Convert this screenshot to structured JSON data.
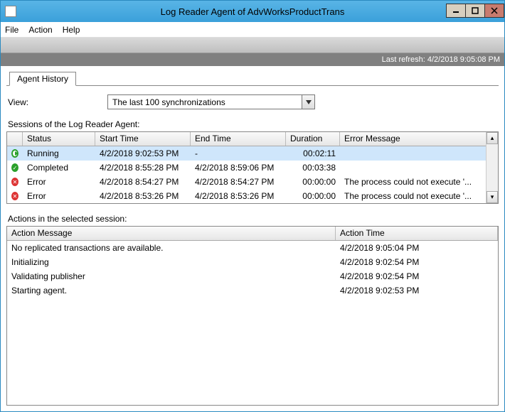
{
  "window": {
    "title": "Log Reader Agent of AdvWorksProductTrans"
  },
  "menu": {
    "file": "File",
    "action": "Action",
    "help": "Help"
  },
  "refresh_bar": "Last refresh: 4/2/2018 9:05:08 PM",
  "tab": {
    "agent_history": "Agent History"
  },
  "view": {
    "label": "View:",
    "selected": "The last 100 synchronizations"
  },
  "sessions": {
    "label": "Sessions of the Log Reader Agent:",
    "columns": {
      "c0": "",
      "status": "Status",
      "start": "Start Time",
      "end": "End Time",
      "duration": "Duration",
      "error": "Error Message"
    },
    "rows": [
      {
        "icon": "running",
        "status": "Running",
        "start": "4/2/2018 9:02:53 PM",
        "end": "-",
        "duration": "00:02:11",
        "error": ""
      },
      {
        "icon": "completed",
        "status": "Completed",
        "start": "4/2/2018 8:55:28 PM",
        "end": "4/2/2018 8:59:06 PM",
        "duration": "00:03:38",
        "error": ""
      },
      {
        "icon": "error",
        "status": "Error",
        "start": "4/2/2018 8:54:27 PM",
        "end": "4/2/2018 8:54:27 PM",
        "duration": "00:00:00",
        "error": "The process could not execute '..."
      },
      {
        "icon": "error",
        "status": "Error",
        "start": "4/2/2018 8:53:26 PM",
        "end": "4/2/2018 8:53:26 PM",
        "duration": "00:00:00",
        "error": "The process could not execute '..."
      }
    ]
  },
  "actions": {
    "label": "Actions in the selected session:",
    "columns": {
      "message": "Action Message",
      "time": "Action Time"
    },
    "rows": [
      {
        "message": "No replicated transactions are available.",
        "time": "4/2/2018 9:05:04 PM"
      },
      {
        "message": "Initializing",
        "time": "4/2/2018 9:02:54 PM"
      },
      {
        "message": "Validating publisher",
        "time": "4/2/2018 9:02:54 PM"
      },
      {
        "message": "Starting agent.",
        "time": "4/2/2018 9:02:53 PM"
      }
    ]
  }
}
